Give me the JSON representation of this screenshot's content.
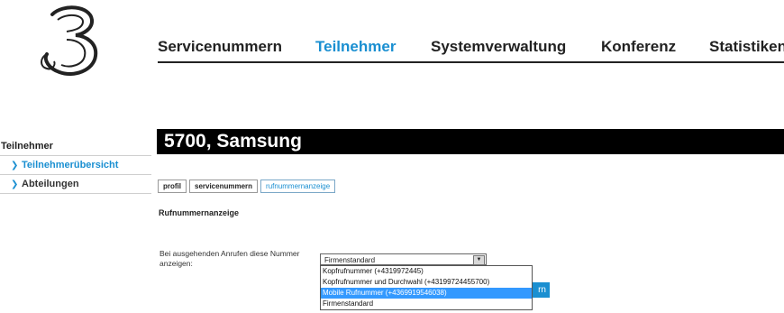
{
  "brand": {
    "logo_icon": "three-logo-icon"
  },
  "nav": {
    "items": [
      {
        "label": "Servicenummern"
      },
      {
        "label": "Teilnehmer"
      },
      {
        "label": "Systemverwaltung"
      },
      {
        "label": "Konferenz"
      },
      {
        "label": "Statistiken"
      }
    ],
    "active_color": "#1a8fd1"
  },
  "sidebar": {
    "heading": "Teilnehmer",
    "items": [
      {
        "label": "Teilnehmerübersicht"
      },
      {
        "label": "Abteilungen"
      }
    ]
  },
  "page": {
    "title": "5700, Samsung",
    "tabs": [
      {
        "label": "profil"
      },
      {
        "label": "servicenummern"
      },
      {
        "label": "rufnummernanzeige"
      }
    ],
    "section_title": "Rufnummernanzeige",
    "field_label": "Bei ausgehenden Anrufen diese Nummer anzeigen:",
    "select": {
      "value": "Firmenstandard",
      "options": [
        "Kopfrufnummer (+4319972445)",
        "Kopfrufnummer und Durchwahl (+43199724455700)",
        "Mobile Rufnummer (+4369919546038)",
        "Firmenstandard"
      ],
      "highlighted_index": 2
    },
    "save_button_visible": "rn"
  }
}
